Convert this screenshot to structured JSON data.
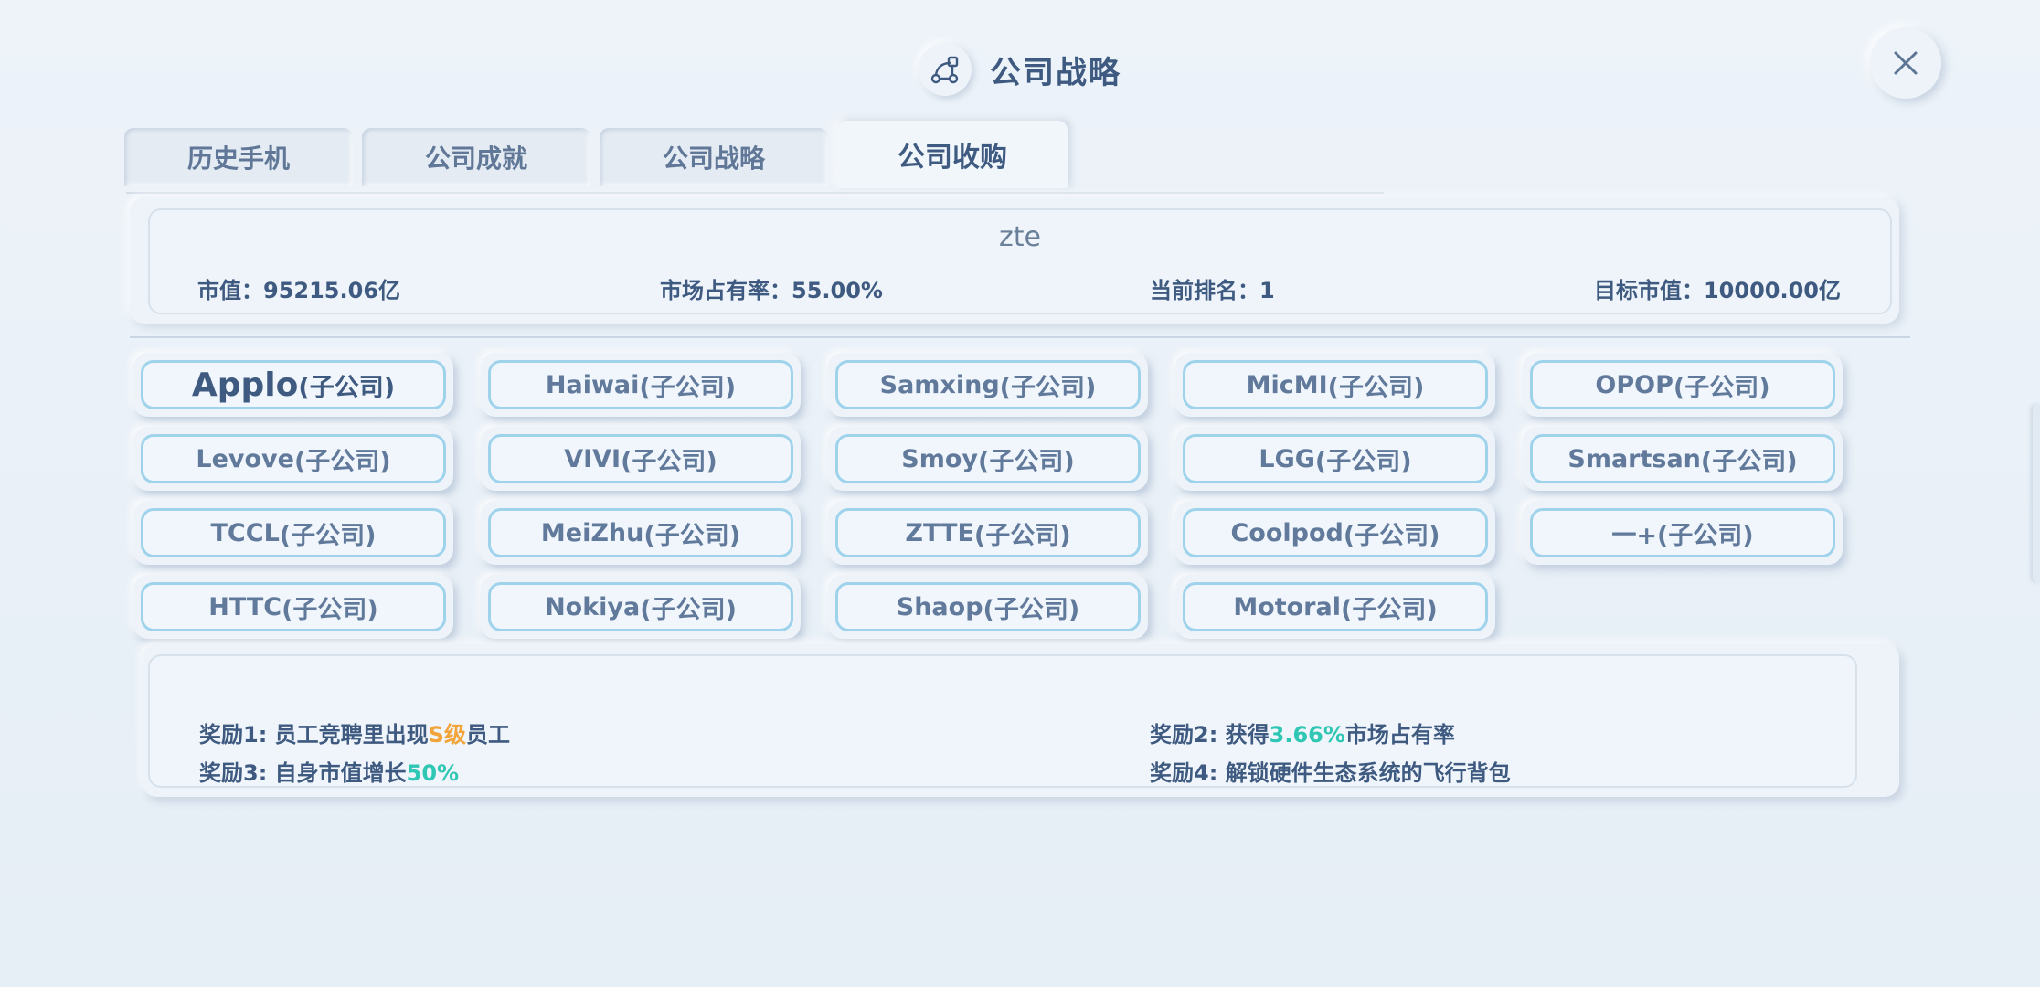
{
  "header": {
    "title": "公司战略",
    "icon": "strategy-network-icon"
  },
  "close_icon": "close-icon",
  "tabs": [
    {
      "label": "历史手机",
      "active": false
    },
    {
      "label": "公司成就",
      "active": false
    },
    {
      "label": "公司战略",
      "active": false
    },
    {
      "label": "公司收购",
      "active": true
    }
  ],
  "company": {
    "name": "zte",
    "market_value_label": "市值：",
    "market_value": "95215.06亿",
    "market_share_label": "市场占有率：",
    "market_share": "55.00%",
    "rank_label": "当前排名：",
    "rank": "1",
    "target_label": "目标市值：",
    "target_value": "10000.00亿"
  },
  "subsidiaries": [
    {
      "brand": "Applo",
      "suffix": "(子公司)"
    },
    {
      "brand": "Haiwai",
      "suffix": "(子公司)"
    },
    {
      "brand": "Samxing",
      "suffix": "(子公司)"
    },
    {
      "brand": "MicMI",
      "suffix": "(子公司)"
    },
    {
      "brand": "OPOP",
      "suffix": "(子公司)"
    },
    {
      "brand": "Levove",
      "suffix": "(子公司)"
    },
    {
      "brand": "VIVI",
      "suffix": "(子公司)"
    },
    {
      "brand": "Smoy",
      "suffix": "(子公司)"
    },
    {
      "brand": "LGG",
      "suffix": "(子公司)"
    },
    {
      "brand": "Smartsan",
      "suffix": "(子公司)"
    },
    {
      "brand": "TCCL",
      "suffix": "(子公司)"
    },
    {
      "brand": "MeiZhu",
      "suffix": "(子公司)"
    },
    {
      "brand": "ZTTE",
      "suffix": "(子公司)"
    },
    {
      "brand": "Coolpod",
      "suffix": "(子公司)"
    },
    {
      "brand": "一+",
      "suffix": "(子公司)"
    },
    {
      "brand": "HTTC",
      "suffix": "(子公司)"
    },
    {
      "brand": "Nokiya",
      "suffix": "(子公司)"
    },
    {
      "brand": "Shaop",
      "suffix": "(子公司)"
    },
    {
      "brand": "Motoral",
      "suffix": "(子公司)"
    }
  ],
  "selected_subsidiary": "Applo",
  "rewards": {
    "r1": {
      "prefix": "奖励1: 员工竞聘里出现",
      "highlight": "S级",
      "suffix": "员工"
    },
    "r2": {
      "prefix": "奖励2: 获得",
      "highlight": "3.66%",
      "suffix": "市场占有率"
    },
    "r3": {
      "prefix": "奖励3: 自身市值增长",
      "highlight": "50%",
      "suffix": ""
    },
    "r4": {
      "prefix": "奖励4: 解锁硬件生态系统的飞行背包",
      "highlight": "",
      "suffix": ""
    }
  },
  "colors": {
    "text": "#3e5a80",
    "button_border": "#9fd3ec",
    "highlight_orange": "#f2a33a",
    "highlight_teal": "#2fc6b4"
  }
}
